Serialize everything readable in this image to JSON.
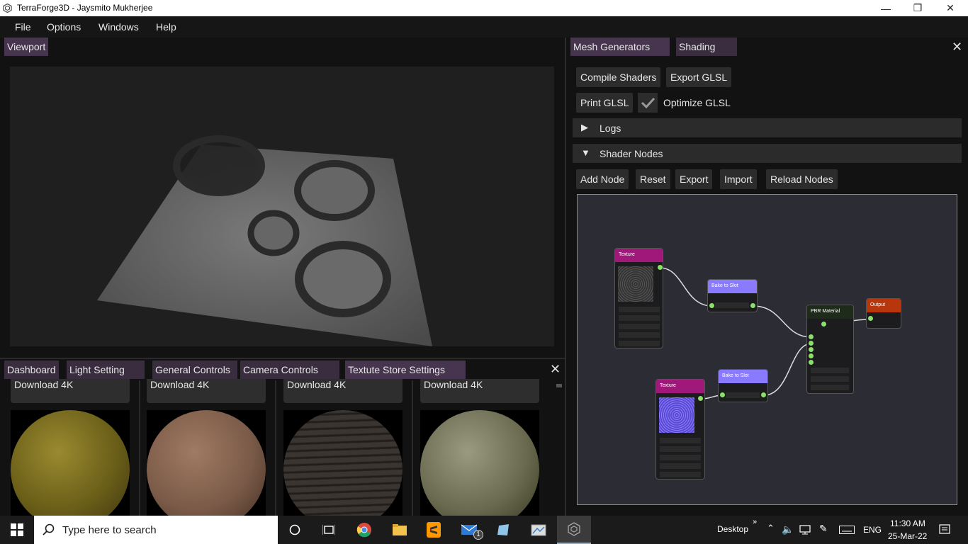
{
  "window": {
    "title": "TerraForge3D - Jaysmito Mukherjee",
    "minimize": "—",
    "restore": "❐",
    "close": "✕"
  },
  "menu": [
    "File",
    "Options",
    "Windows",
    "Help"
  ],
  "viewport": {
    "tab": "Viewport"
  },
  "bottom_panel": {
    "tabs": [
      "Dashboard",
      "Light Setting",
      "General Controls",
      "Camera Controls",
      "Textute Store Settings"
    ],
    "close": "✕",
    "download_label": "Download 4K",
    "textures": [
      {
        "color": "#7a6a1e",
        "icon": "mossy-yellow-sphere"
      },
      {
        "color": "#7a5a48",
        "icon": "brown-rock-sphere"
      },
      {
        "color": "#3a3530",
        "icon": "dark-bark-sphere"
      },
      {
        "color": "#6a6a50",
        "icon": "mossy-stone-sphere"
      }
    ]
  },
  "right_panel": {
    "tabs": [
      "Mesh Generators",
      "Shading"
    ],
    "close": "✕",
    "buttons_row1": [
      "Compile Shaders",
      "Export GLSL"
    ],
    "print_glsl": "Print GLSL",
    "optimize_glsl": "Optimize GLSL",
    "optimize_checked": true,
    "logs": {
      "label": "Logs",
      "arrow": "▶"
    },
    "shader_nodes": {
      "label": "Shader Nodes",
      "arrow": "▼"
    },
    "node_buttons": [
      "Add Node",
      "Reset",
      "Export",
      "Import",
      "Reload Nodes"
    ],
    "nodes": {
      "texture1": {
        "title": "Texture",
        "color": "#a0187a"
      },
      "bake1": {
        "title": "Bake to Slot",
        "color": "#8a7aff"
      },
      "pbr": {
        "title": "PBR Material",
        "color": "#1e2a1a"
      },
      "output": {
        "title": "Output",
        "color": "#b8360c"
      },
      "texture2": {
        "title": "Texture",
        "color": "#a0187a"
      },
      "bake2": {
        "title": "Bake to Slot",
        "color": "#8a7aff"
      }
    }
  },
  "taskbar": {
    "search_placeholder": "Type here to search",
    "desktop_label": "Desktop",
    "language": "ENG",
    "time": "11:30 AM",
    "date": "25-Mar-22",
    "mail_badge": "1"
  }
}
